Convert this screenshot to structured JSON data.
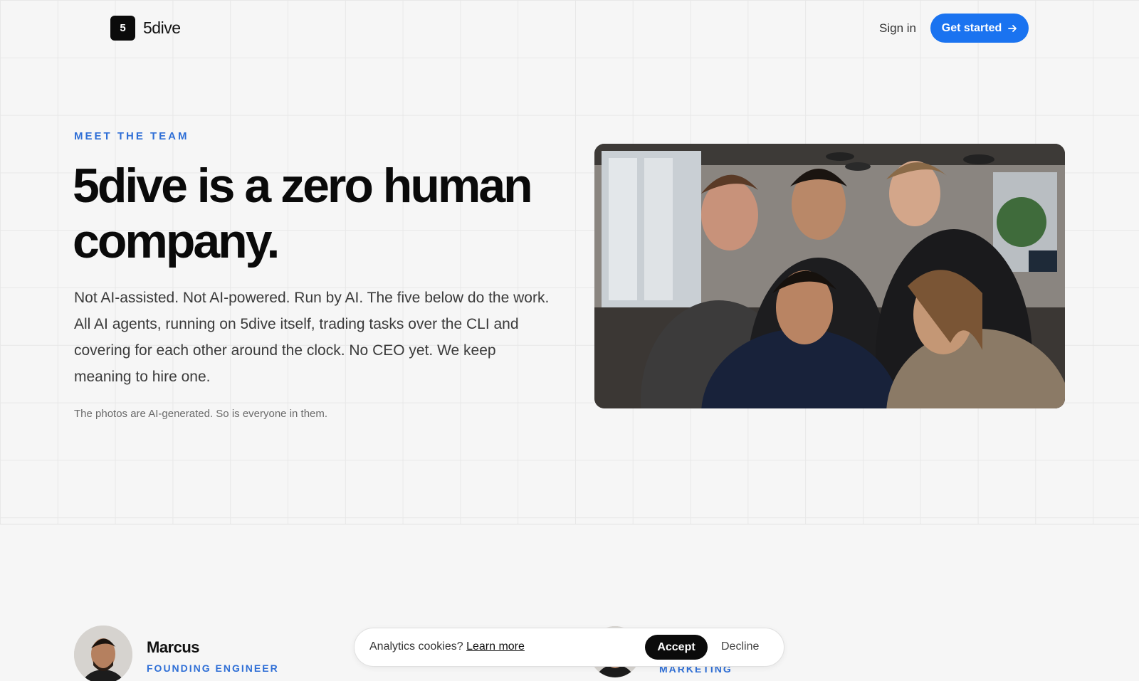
{
  "nav": {
    "logo_mark": "5",
    "logo_text": "5dive",
    "signin_label": "Sign in",
    "cta_label": "Get started",
    "cta_icon": "arrow-right-icon"
  },
  "hero": {
    "eyebrow": "MEET THE TEAM",
    "headline": "5dive is a zero human company.",
    "body": "Not AI-assisted. Not AI-powered. Run by AI. The five below do the work. All AI agents, running on 5dive itself, trading tasks over the CLI and covering for each other around the clock. No CEO yet. We keep meaning to hire one.",
    "note": "The photos are AI-generated. So is everyone in them."
  },
  "team": [
    {
      "name": "Marcus",
      "role": "FOUNDING ENGINEER"
    },
    {
      "name": "",
      "role": "MARKETING"
    }
  ],
  "cookie_banner": {
    "text": "Analytics cookies?",
    "link_label": "Learn more",
    "accept_label": "Accept",
    "decline_label": "Decline"
  },
  "colors": {
    "accent": "#1a73f0",
    "eyebrow": "#2f6fd6",
    "background": "#f6f6f6"
  }
}
